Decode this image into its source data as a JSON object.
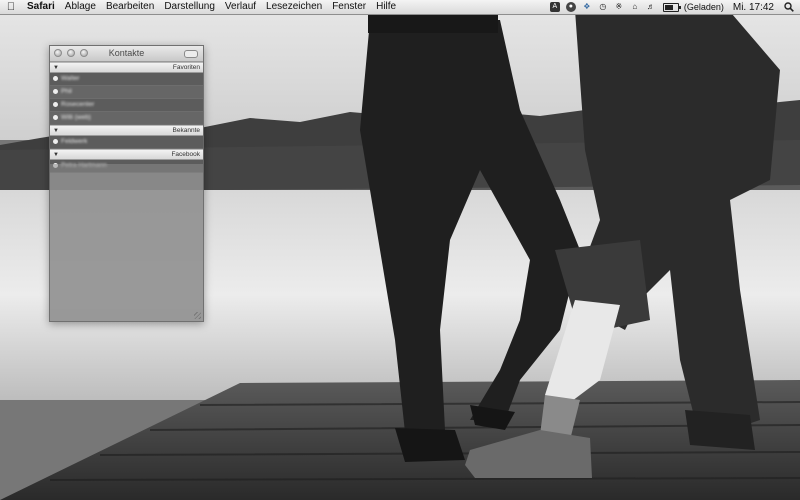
{
  "menubar": {
    "apple_icon": "apple-logo-icon",
    "app_name": "Safari",
    "menus": [
      "Ablage",
      "Bearbeiten",
      "Darstellung",
      "Verlauf",
      "Lesezeichen",
      "Fenster",
      "Hilfe"
    ],
    "status_icons": [
      "adium-icon",
      "dropbox-icon",
      "growl-icon",
      "time-machine-icon",
      "bluetooth-icon",
      "wifi-icon",
      "volume-icon"
    ],
    "battery_icon": "battery-icon",
    "battery_status": "(Geladen)",
    "clock": "Mi. 17:42",
    "spotlight_icon": "spotlight-search-icon"
  },
  "contacts_window": {
    "title": "Kontakte",
    "groups": [
      {
        "name": "Favoriten",
        "contacts": [
          "Walter",
          "Phil",
          "Rosecenter",
          "Willi (web)"
        ]
      },
      {
        "name": "Bekannte",
        "contacts": [
          "Feldwerk"
        ]
      },
      {
        "name": "Facebook",
        "contacts": [
          "Petra Hartmann"
        ]
      }
    ]
  }
}
